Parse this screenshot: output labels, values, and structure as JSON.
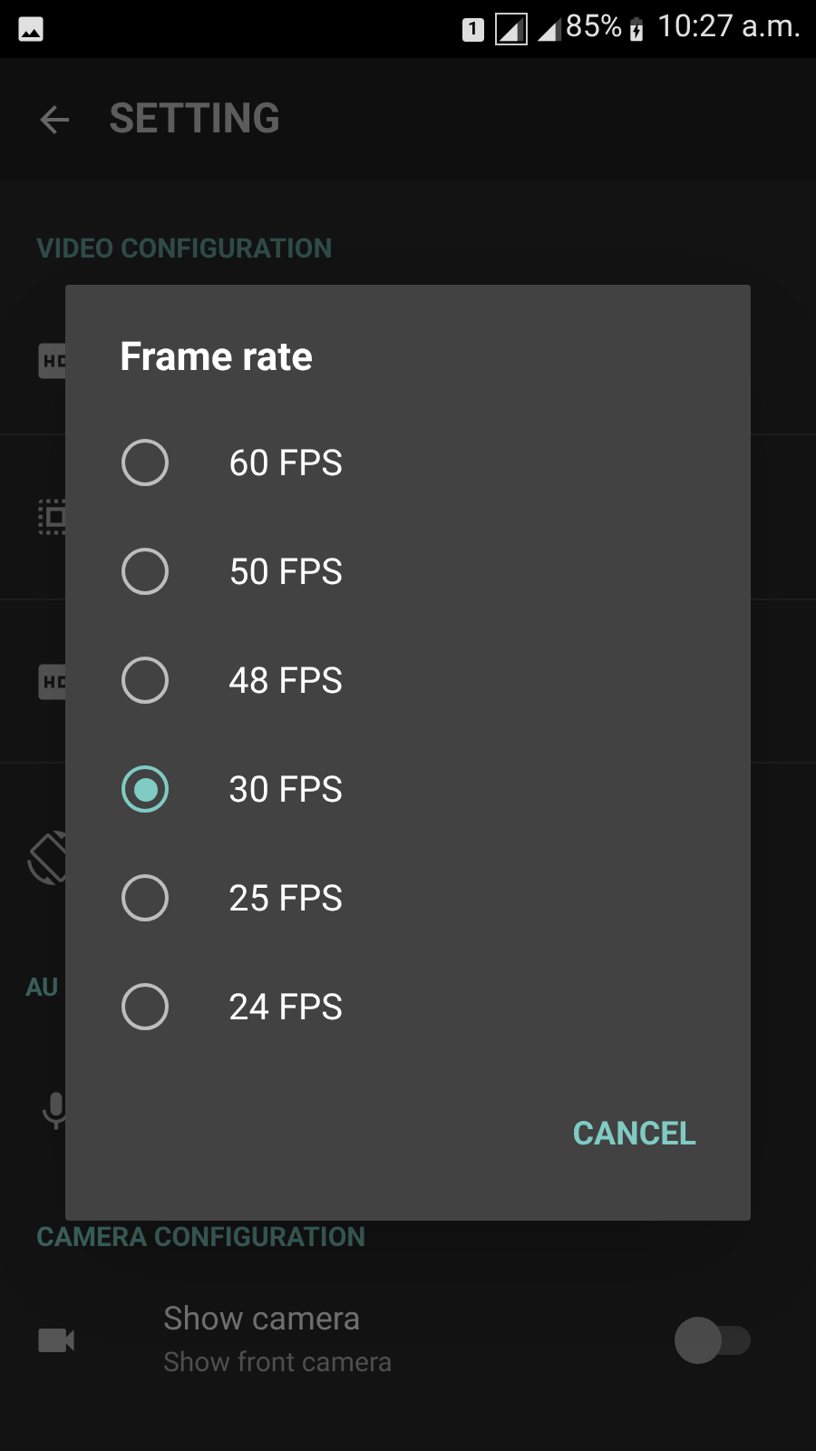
{
  "status_bar": {
    "sim": "1",
    "battery": "85%",
    "time": "10:27 a.m."
  },
  "app_bar": {
    "title": "SETTING"
  },
  "sections": [
    {
      "kind": "video",
      "header": "VIDEO CONFIGURATION"
    },
    {
      "kind": "audio",
      "header": "AU"
    },
    {
      "kind": "camera",
      "header": "CAMERA CONFIGURATION",
      "row": {
        "title": "Show camera",
        "subtitle": "Show front camera",
        "on": false
      }
    }
  ],
  "dialog": {
    "title": "Frame rate",
    "options": [
      {
        "label": "60 FPS",
        "selected": false
      },
      {
        "label": "50 FPS",
        "selected": false
      },
      {
        "label": "48 FPS",
        "selected": false
      },
      {
        "label": "30 FPS",
        "selected": true
      },
      {
        "label": "25 FPS",
        "selected": false
      },
      {
        "label": "24 FPS",
        "selected": false
      }
    ],
    "button": "CANCEL"
  }
}
